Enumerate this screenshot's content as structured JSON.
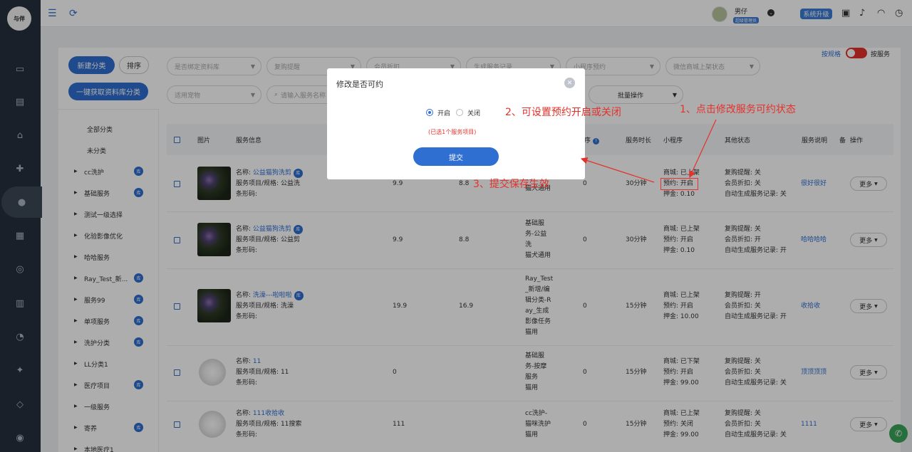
{
  "brand": {
    "logo_text": "与伴"
  },
  "user": {
    "name": "男仔",
    "role_badge": "超级管理员"
  },
  "header": {
    "upgrade_label": "系统升级"
  },
  "toggle": {
    "left_label": "按规格",
    "right_label": "按服务"
  },
  "sidebar_buttons": {
    "new_category": "新建分类",
    "sort": "排序",
    "fetch_categories": "一键获取资料库分类"
  },
  "categories": {
    "all": "全部分类",
    "uncategorized": "未分类",
    "items": [
      {
        "label": "cc洗护",
        "badge": "库"
      },
      {
        "label": "基础服务",
        "badge": "库"
      },
      {
        "label": "测试一级选择",
        "badge": ""
      },
      {
        "label": "化验影像优化",
        "badge": ""
      },
      {
        "label": "哈哈服务",
        "badge": ""
      },
      {
        "label": "Ray_Test_新...",
        "badge": "库"
      },
      {
        "label": "服务99",
        "badge": "库"
      },
      {
        "label": "单项服务",
        "badge": "库"
      },
      {
        "label": "洗护分类",
        "badge": "库"
      },
      {
        "label": "LL分类1",
        "badge": ""
      },
      {
        "label": "医疗项目",
        "badge": "库"
      },
      {
        "label": "一级服务",
        "badge": ""
      },
      {
        "label": "寄养",
        "badge": "库"
      },
      {
        "label": "本地医疗1",
        "badge": ""
      }
    ]
  },
  "filters": {
    "row1": [
      "是否绑定资料库",
      "复购提醒",
      "会员折扣",
      "生成服务记录",
      "小程序预约",
      "微信商城上架状态"
    ],
    "row2": [
      "适用宠物",
      "请输入服务名称"
    ],
    "batch": "批量操作"
  },
  "table": {
    "headers": {
      "image": "图片",
      "info": "服务信息",
      "sort": "序",
      "duration": "服务时长",
      "mini": "小程序",
      "other": "其他状态",
      "desc": "服务说明",
      "remark": "备",
      "action": "操作"
    },
    "labels": {
      "name": "名称:",
      "spec": "服务项目/规格:",
      "barcode": "条形码:",
      "more": "更多",
      "mall": "商城:",
      "booking": "预约:",
      "deposit": "押金:"
    },
    "rows": [
      {
        "name": "公益猫狗洗剪",
        "ku": "库",
        "spec": "公益洗",
        "price": "9.9",
        "member_price": "8.8",
        "category": [
          "洗",
          "猫犬通用"
        ],
        "sort": "0",
        "duration": "30分钟",
        "mall": "已上架",
        "booking": "开启",
        "deposit": "0.10",
        "other": [
          "复购提醒: 关",
          "会员折扣: 关",
          "自动生成服务记录: 关"
        ],
        "desc": "很好很好"
      },
      {
        "name": "公益猫狗洗剪",
        "ku": "库",
        "spec": "公益剪",
        "price": "9.9",
        "member_price": "8.8",
        "category": [
          "基础服",
          "务-公益",
          "洗",
          "猫犬通用"
        ],
        "sort": "0",
        "duration": "30分钟",
        "mall": "已上架",
        "booking": "开启",
        "deposit": "0.10",
        "other": [
          "复购提醒: 关",
          "会员折扣: 开",
          "自动生成服务记录: 开"
        ],
        "desc": "哈哈哈哈"
      },
      {
        "name": "洗澡---啦啦啦",
        "ku": "库",
        "spec": "洗澡",
        "price": "19.9",
        "member_price": "16.9",
        "category": [
          "Ray_Test",
          "_新增/编",
          "辑分类-R",
          "ay_生成",
          "影像任务",
          "猫用"
        ],
        "sort": "0",
        "duration": "15分钟",
        "mall": "已上架",
        "booking": "开启",
        "deposit": "10.00",
        "other": [
          "复购提醒: 开",
          "会员折扣: 关",
          "自动生成服务记录: 开"
        ],
        "desc": "收拾收"
      },
      {
        "name": "11",
        "ku": "",
        "spec": "11",
        "price": "0",
        "member_price": "",
        "category": [
          "基础服",
          "务-按摩",
          "服务",
          "猫用"
        ],
        "sort": "0",
        "duration": "15分钟",
        "mall": "已下架",
        "booking": "开启",
        "deposit": "99.00",
        "other": [
          "复购提醒: 关",
          "会员折扣: 关",
          "自动生成服务记录: 关"
        ],
        "desc": "顶顶顶顶"
      },
      {
        "name": "111收拾收",
        "ku": "",
        "spec": "11搜索",
        "price": "111",
        "member_price": "",
        "category": [
          "cc洗护-",
          "猫咪洗护",
          "猫用"
        ],
        "sort": "0",
        "duration": "15分钟",
        "mall": "已上架",
        "booking": "关闭",
        "deposit": "99.00",
        "other": [
          "复购提醒: 关",
          "会员折扣: 关",
          "自动生成服务记录: 关"
        ],
        "desc": "1111"
      }
    ]
  },
  "modal": {
    "title": "修改是否可约",
    "option_on": "开启",
    "option_off": "关闭",
    "selected_note": "(已选1个服务项目)",
    "submit": "提交"
  },
  "annotations": {
    "step1": "1、点击修改服务可约状态",
    "step2": "2、可设置预约开启或关闭",
    "step3": "3、提交保存生效"
  },
  "colors": {
    "primary": "#2f6fd1",
    "nav_bg": "#25303d",
    "annotation": "#e5312b"
  }
}
